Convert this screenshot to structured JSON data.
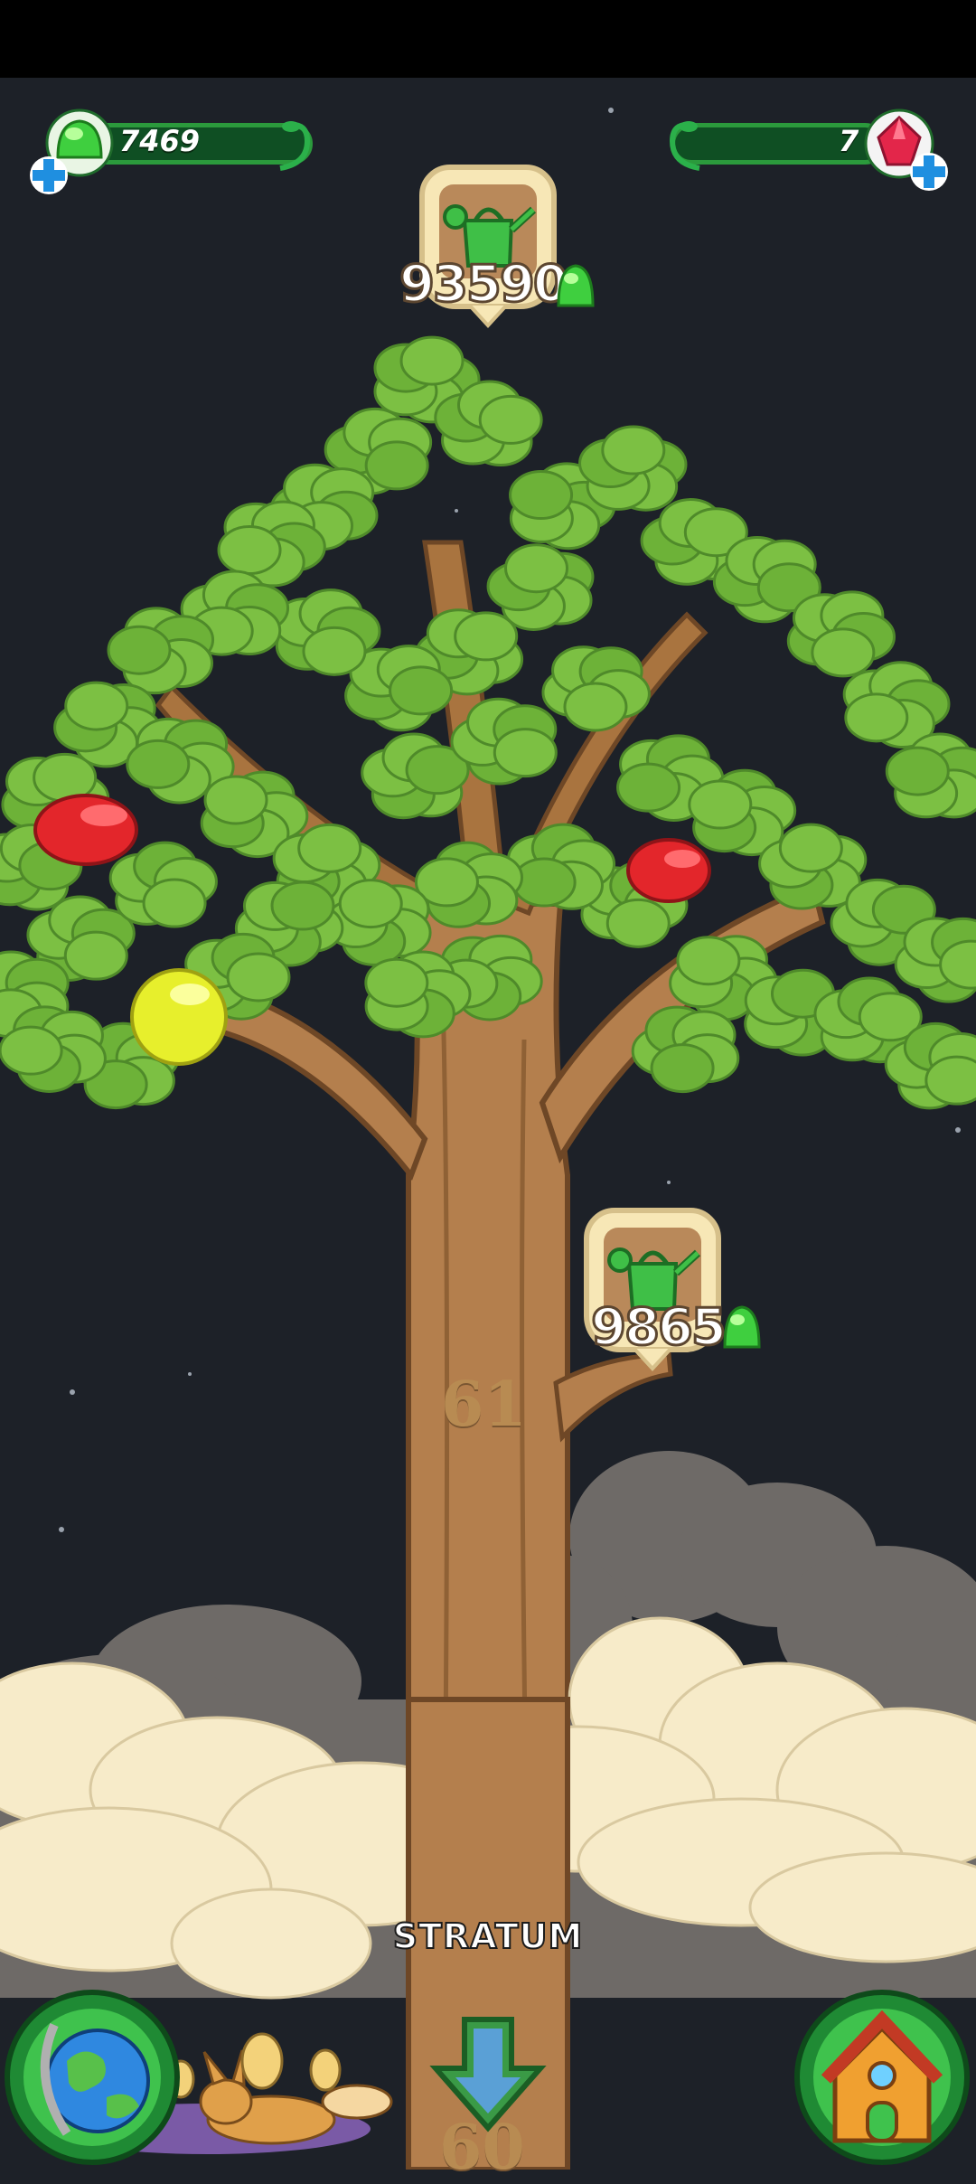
{
  "hud": {
    "gum_count": "7469",
    "gem_count": "7"
  },
  "badges": [
    {
      "value": "93590",
      "icon": "watering-can-icon",
      "currency_icon": "green-gum-icon"
    },
    {
      "value": "9865",
      "icon": "watering-can-icon",
      "currency_icon": "green-gum-icon"
    }
  ],
  "tree": {
    "level_current": "61",
    "level_below": "60",
    "zone_label": "STRATUM"
  },
  "buttons": {
    "world_icon": "globe-icon",
    "home_icon": "house-icon",
    "down_icon": "down-arrow-icon"
  },
  "colors": {
    "background": "#1d2128",
    "leaf": "#7cc043",
    "leaf_dark": "#4f8a2a",
    "trunk": "#b47f4d",
    "hud_green": "#2b9a3c",
    "badge_cream": "#f7e7b6"
  }
}
